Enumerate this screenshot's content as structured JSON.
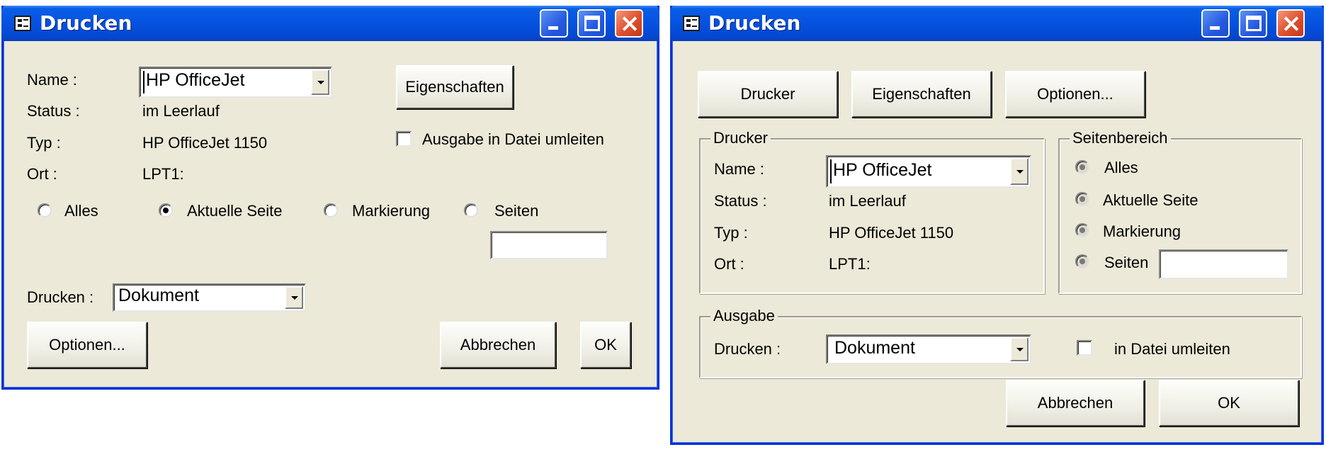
{
  "dialog1": {
    "title": "Drucken",
    "name_label": "Name :",
    "name_value": "HP OfficeJet",
    "status_label": "Status :",
    "status_value": "im Leerlauf",
    "typ_label": "Typ :",
    "typ_value": "HP OfficeJet 1150",
    "ort_label": "Ort :",
    "ort_value": "LPT1:",
    "properties_button": "Eigenschaften",
    "print_to_file_label": "Ausgabe in Datei umleiten",
    "radios": [
      {
        "label": "Alles",
        "checked": false
      },
      {
        "label": "Aktuelle Seite",
        "checked": true
      },
      {
        "label": "Markierung",
        "checked": false
      },
      {
        "label": "Seiten",
        "checked": false
      }
    ],
    "pages_value": "",
    "drucken_label": "Drucken :",
    "drucken_value": "Dokument",
    "options_button": "Optionen...",
    "cancel_button": "Abbrechen",
    "ok_button": "OK"
  },
  "dialog2": {
    "title": "Drucken",
    "printer_button": "Drucker",
    "properties_button": "Eigenschaften",
    "options_button": "Optionen...",
    "printer_group": {
      "title": "Drucker",
      "name_label": "Name :",
      "name_value": "HP OfficeJet",
      "status_label": "Status :",
      "status_value": "im Leerlauf",
      "typ_label": "Typ :",
      "typ_value": "HP OfficeJet 1150",
      "ort_label": "Ort :",
      "ort_value": "LPT1:"
    },
    "range_group": {
      "title": "Seitenbereich",
      "options": [
        "Alles",
        "Aktuelle Seite",
        "Markierung",
        "Seiten"
      ],
      "pages_value": ""
    },
    "output_group": {
      "title": "Ausgabe",
      "drucken_label": "Drucken :",
      "drucken_value": "Dokument",
      "file_label": "in Datei umleiten"
    },
    "cancel_button": "Abbrechen",
    "ok_button": "OK"
  },
  "colors": {
    "titlebar": "#0552e0",
    "face": "#ece9d8",
    "close": "#de4f2e"
  }
}
